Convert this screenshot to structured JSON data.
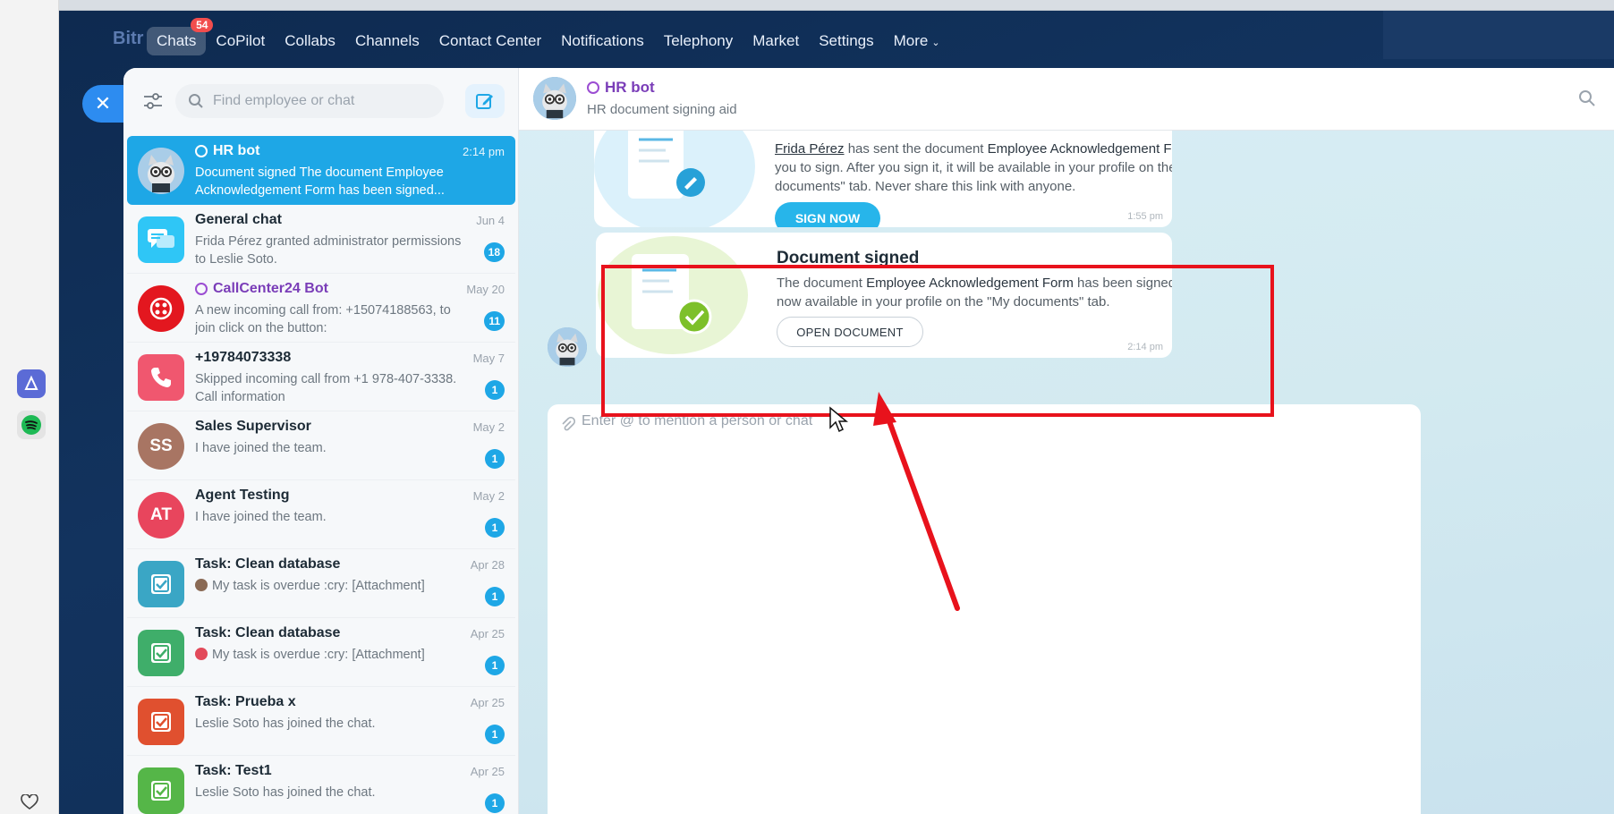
{
  "nav": {
    "brand": "Bitr",
    "items": [
      {
        "label": "Chats",
        "badge": "54",
        "active": true
      },
      {
        "label": "CoPilot"
      },
      {
        "label": "Collabs"
      },
      {
        "label": "Channels"
      },
      {
        "label": "Contact Center"
      },
      {
        "label": "Notifications"
      },
      {
        "label": "Telephony"
      },
      {
        "label": "Market"
      },
      {
        "label": "Settings"
      },
      {
        "label": "More"
      }
    ]
  },
  "sidebar": {
    "search_placeholder": "Find employee or chat",
    "chats": [
      {
        "name": "HR bot",
        "date": "2:14 pm",
        "preview": "Document signed The document Employee Acknowledgement Form has been signed...",
        "bot": true
      },
      {
        "name": "General chat",
        "date": "Jun 4",
        "preview": "Frida Pérez granted administrator permissions to Leslie Soto.",
        "count": "18"
      },
      {
        "name": "CallCenter24 Bot",
        "date": "May 20",
        "preview": "A new incoming call from: +15074188563, to join click on the button:",
        "count": "11",
        "bot": true
      },
      {
        "name": "+19784073338",
        "date": "May 7",
        "preview": "Skipped incoming call from +1 978-407-3338. Call information",
        "count": "1"
      },
      {
        "name": "Sales Supervisor",
        "date": "May 2",
        "preview": "I have joined the team.",
        "count": "1",
        "initials": "SS"
      },
      {
        "name": "Agent Testing",
        "date": "May 2",
        "preview": "I have joined the team.",
        "count": "1",
        "initials": "AT"
      },
      {
        "name": "Task: Clean database",
        "date": "Apr 28",
        "preview": "My task is overdue :cry: [Attachment]",
        "count": "1"
      },
      {
        "name": "Task: Clean database",
        "date": "Apr 25",
        "preview": "My task is overdue :cry: [Attachment]",
        "count": "1"
      },
      {
        "name": "Task: Prueba x",
        "date": "Apr 25",
        "preview": "Leslie Soto has joined the chat.",
        "count": "1"
      },
      {
        "name": "Task: Test1",
        "date": "Apr 25",
        "preview": "Leslie Soto has joined the chat.",
        "count": "1"
      }
    ]
  },
  "chat": {
    "title": "HR bot",
    "subtitle": "HR document signing aid",
    "msg1": {
      "author": "Frida Pérez",
      "text_a": " has sent the document ",
      "doc": "Employee Acknowledgement Form",
      "text_b": " for you to sign. After you sign it, it will be available in your profile on the \"My documents\" tab. Never share this link with anyone.",
      "button": "SIGN NOW",
      "time": "1:55 pm"
    },
    "msg2": {
      "title": "Document signed",
      "text_a": "The document ",
      "doc": "Employee Acknowledgement Form",
      "text_b": " has been signed and is now available in your profile on the \"My documents\" tab.",
      "button": "OPEN DOCUMENT",
      "time": "2:14 pm"
    },
    "composer_placeholder": "Enter @ to mention a person or chat"
  },
  "colors": {
    "accent": "#1ea7e6",
    "highlight": "#e8121c",
    "bot": "#9b4dd2"
  }
}
